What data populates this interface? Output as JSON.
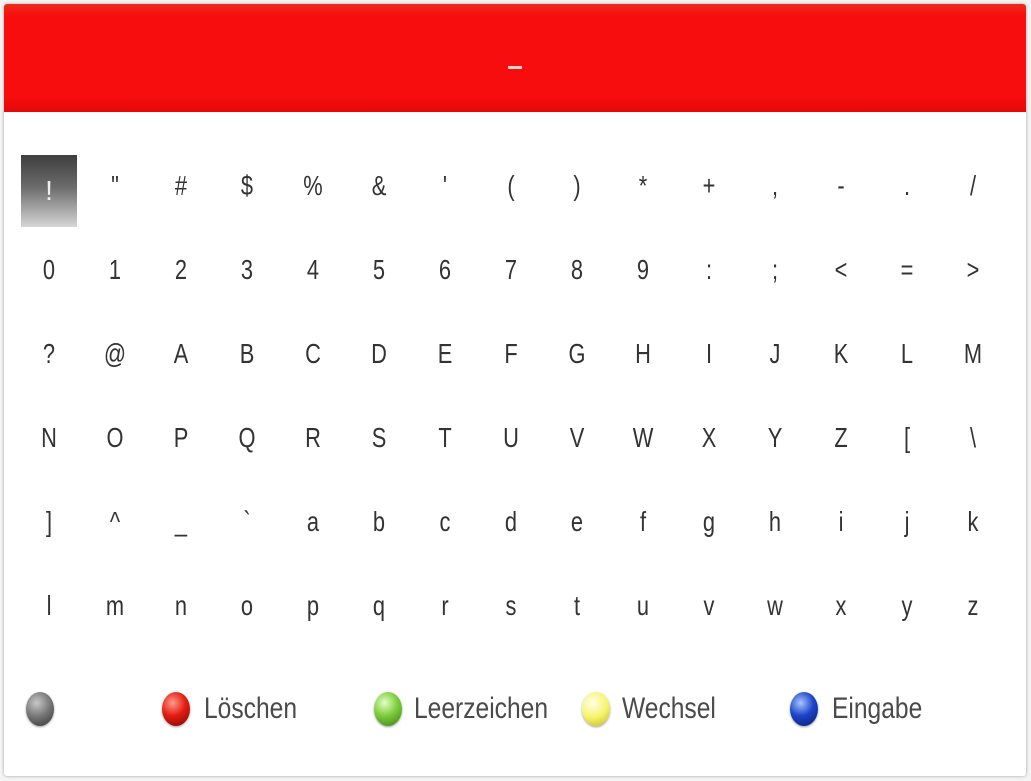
{
  "input": {
    "value": "_"
  },
  "keyboard": {
    "selected_index": 0,
    "keys": [
      "!",
      "\"",
      "#",
      "$",
      "%",
      "&",
      "'",
      "(",
      ")",
      "*",
      "+",
      ",",
      "-",
      ".",
      "/",
      "0",
      "1",
      "2",
      "3",
      "4",
      "5",
      "6",
      "7",
      "8",
      "9",
      ":",
      ";",
      "<",
      "=",
      ">",
      "?",
      "@",
      "A",
      "B",
      "C",
      "D",
      "E",
      "F",
      "G",
      "H",
      "I",
      "J",
      "K",
      "L",
      "M",
      "N",
      "O",
      "P",
      "Q",
      "R",
      "S",
      "T",
      "U",
      "V",
      "W",
      "X",
      "Y",
      "Z",
      "[",
      "\\",
      "]",
      "^",
      "_",
      "`",
      "a",
      "b",
      "c",
      "d",
      "e",
      "f",
      "g",
      "h",
      "i",
      "j",
      "k",
      "l",
      "m",
      "n",
      "o",
      "p",
      "q",
      "r",
      "s",
      "t",
      "u",
      "v",
      "w",
      "x",
      "y",
      "z"
    ]
  },
  "legend": {
    "grey_icon": "grey-button-icon",
    "red_label": "Löschen",
    "green_label": "Leerzeichen",
    "yellow_label": "Wechsel",
    "blue_label": "Eingabe"
  },
  "colors": {
    "header_red": "#f70d0d",
    "key_text": "#333333",
    "legend_text": "#4a4a4a",
    "red_button": "#e21c10",
    "green_button": "#7ccc3c",
    "yellow_button": "#f7f46e",
    "blue_button": "#1c44c8"
  }
}
